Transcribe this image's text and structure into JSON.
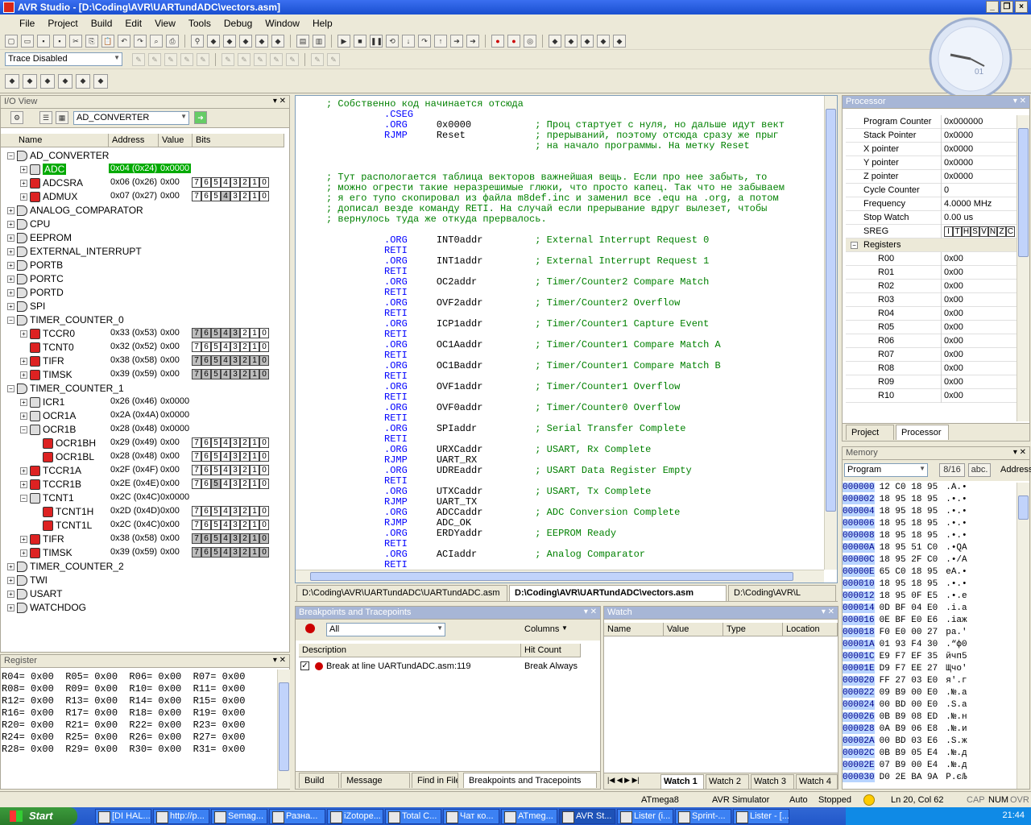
{
  "window": {
    "title": "AVR Studio - [D:\\Coding\\AVR\\UARTundADC\\vectors.asm]",
    "min": "_",
    "max": "❐",
    "close": "×"
  },
  "menu": [
    "File",
    "Project",
    "Build",
    "Edit",
    "View",
    "Tools",
    "Debug",
    "Window",
    "Help"
  ],
  "trace_combo": "Trace Disabled",
  "io_view": {
    "title": "I/O View",
    "combo": "AD_CONVERTER",
    "columns": [
      "Name",
      "Address",
      "Value",
      "Bits"
    ],
    "rows": [
      {
        "depth": 0,
        "exp": "−",
        "name": "AD_CONVERTER"
      },
      {
        "depth": 1,
        "exp": "+",
        "name": "ADC",
        "addr": "0x04 (0x24)",
        "val": "0x0000",
        "sel": true
      },
      {
        "depth": 1,
        "exp": "+",
        "name": "ADCSRA",
        "addr": "0x06 (0x26)",
        "val": "0x00",
        "bits": "76543210",
        "g": "00000000"
      },
      {
        "depth": 1,
        "exp": "+",
        "name": "ADMUX",
        "addr": "0x07 (0x27)",
        "val": "0x00",
        "bits": "76543210",
        "g": "00010000"
      },
      {
        "depth": 0,
        "exp": "+",
        "name": "ANALOG_COMPARATOR"
      },
      {
        "depth": 0,
        "exp": "+",
        "name": "CPU"
      },
      {
        "depth": 0,
        "exp": "+",
        "name": "EEPROM"
      },
      {
        "depth": 0,
        "exp": "+",
        "name": "EXTERNAL_INTERRUPT"
      },
      {
        "depth": 0,
        "exp": "+",
        "name": "PORTB"
      },
      {
        "depth": 0,
        "exp": "+",
        "name": "PORTC"
      },
      {
        "depth": 0,
        "exp": "+",
        "name": "PORTD"
      },
      {
        "depth": 0,
        "exp": "+",
        "name": "SPI"
      },
      {
        "depth": 0,
        "exp": "−",
        "name": "TIMER_COUNTER_0"
      },
      {
        "depth": 1,
        "exp": "+",
        "name": "TCCR0",
        "addr": "0x33 (0x53)",
        "val": "0x00",
        "bits": "76543210",
        "g": "11111000"
      },
      {
        "depth": 1,
        "exp": "",
        "name": "TCNT0",
        "addr": "0x32 (0x52)",
        "val": "0x00",
        "bits": "76543210",
        "g": "00000000"
      },
      {
        "depth": 1,
        "exp": "+",
        "name": "TIFR",
        "addr": "0x38 (0x58)",
        "val": "0x00",
        "bits": "76543210",
        "g": "11111111"
      },
      {
        "depth": 1,
        "exp": "+",
        "name": "TIMSK",
        "addr": "0x39 (0x59)",
        "val": "0x00",
        "bits": "76543210",
        "g": "11111111"
      },
      {
        "depth": 0,
        "exp": "−",
        "name": "TIMER_COUNTER_1"
      },
      {
        "depth": 1,
        "exp": "+",
        "name": "ICR1",
        "addr": "0x26 (0x46)",
        "val": "0x0000"
      },
      {
        "depth": 1,
        "exp": "+",
        "name": "OCR1A",
        "addr": "0x2A (0x4A)",
        "val": "0x0000"
      },
      {
        "depth": 1,
        "exp": "−",
        "name": "OCR1B",
        "addr": "0x28 (0x48)",
        "val": "0x0000"
      },
      {
        "depth": 2,
        "exp": "",
        "name": "OCR1BH",
        "addr": "0x29 (0x49)",
        "val": "0x00",
        "bits": "76543210",
        "g": "00000000"
      },
      {
        "depth": 2,
        "exp": "",
        "name": "OCR1BL",
        "addr": "0x28 (0x48)",
        "val": "0x00",
        "bits": "76543210",
        "g": "00000000"
      },
      {
        "depth": 1,
        "exp": "+",
        "name": "TCCR1A",
        "addr": "0x2F (0x4F)",
        "val": "0x00",
        "bits": "76543210",
        "g": "00000000"
      },
      {
        "depth": 1,
        "exp": "+",
        "name": "TCCR1B",
        "addr": "0x2E (0x4E)",
        "val": "0x00",
        "bits": "76543210",
        "g": "00100000"
      },
      {
        "depth": 1,
        "exp": "−",
        "name": "TCNT1",
        "addr": "0x2C (0x4C)",
        "val": "0x0000"
      },
      {
        "depth": 2,
        "exp": "",
        "name": "TCNT1H",
        "addr": "0x2D (0x4D)",
        "val": "0x00",
        "bits": "76543210",
        "g": "00000000"
      },
      {
        "depth": 2,
        "exp": "",
        "name": "TCNT1L",
        "addr": "0x2C (0x4C)",
        "val": "0x00",
        "bits": "76543210",
        "g": "00000000"
      },
      {
        "depth": 1,
        "exp": "+",
        "name": "TIFR",
        "addr": "0x38 (0x58)",
        "val": "0x00",
        "bits": "76543210",
        "g": "11111111"
      },
      {
        "depth": 1,
        "exp": "+",
        "name": "TIMSK",
        "addr": "0x39 (0x59)",
        "val": "0x00",
        "bits": "76543210",
        "g": "11111111"
      },
      {
        "depth": 0,
        "exp": "+",
        "name": "TIMER_COUNTER_2"
      },
      {
        "depth": 0,
        "exp": "+",
        "name": "TWI"
      },
      {
        "depth": 0,
        "exp": "+",
        "name": "USART"
      },
      {
        "depth": 0,
        "exp": "+",
        "name": "WATCHDOG"
      }
    ]
  },
  "register_panel": {
    "title": "Register",
    "lines": [
      "R04= 0x00  R05= 0x00  R06= 0x00  R07= 0x00",
      "R08= 0x00  R09= 0x00  R10= 0x00  R11= 0x00",
      "R12= 0x00  R13= 0x00  R14= 0x00  R15= 0x00",
      "R16= 0x00  R17= 0x00  R18= 0x00  R19= 0x00",
      "R20= 0x00  R21= 0x00  R22= 0x00  R23= 0x00",
      "R24= 0x00  R25= 0x00  R26= 0x00  R27= 0x00",
      "R28= 0x00  R29= 0x00  R30= 0x00  R31= 0x00"
    ]
  },
  "editor": {
    "lines": [
      {
        "t": "c",
        "s": "; Собственно код начинается отсюда"
      },
      {
        "t": "d",
        "s": "          .CSEG"
      },
      {
        "t": "d",
        "s": "          .ORG     0x0000           ; Проц стартует с нуля, но дальше идут вект"
      },
      {
        "t": "d",
        "s": "          RJMP     Reset            ; прерываний, поэтому отсюда сразу же прыг",
        "arrow": true
      },
      {
        "t": "c",
        "s": "                                    ; на начало программы. На метку Reset"
      },
      {
        "t": "b",
        "s": ""
      },
      {
        "t": "b",
        "s": ""
      },
      {
        "t": "c",
        "s": "; Тут распологается таблица векторов важнейшая вещь. Если про нее забыть, то"
      },
      {
        "t": "c",
        "s": "; можно огрести такие неразрешимые глюки, что просто капец. Так что не забываем"
      },
      {
        "t": "c",
        "s": "; я его тупо скопировал из файла m8def.inc и заменил все .equ на .org, а потом"
      },
      {
        "t": "c",
        "s": "; дописал везде команду RETI. На случай если прерывание вдруг вылезет, чтобы"
      },
      {
        "t": "c",
        "s": "; вернулось туда же откуда прервалось."
      },
      {
        "t": "b",
        "s": ""
      },
      {
        "t": "d",
        "s": "          .ORG     INT0addr         ; External Interrupt Request 0"
      },
      {
        "t": "k",
        "s": "          RETI"
      },
      {
        "t": "d",
        "s": "          .ORG     INT1addr         ; External Interrupt Request 1"
      },
      {
        "t": "k",
        "s": "          RETI"
      },
      {
        "t": "d",
        "s": "          .ORG     OC2addr          ; Timer/Counter2 Compare Match"
      },
      {
        "t": "k",
        "s": "          RETI"
      },
      {
        "t": "d",
        "s": "          .ORG     OVF2addr         ; Timer/Counter2 Overflow"
      },
      {
        "t": "k",
        "s": "          RETI"
      },
      {
        "t": "d",
        "s": "          .ORG     ICP1addr         ; Timer/Counter1 Capture Event"
      },
      {
        "t": "k",
        "s": "          RETI"
      },
      {
        "t": "d",
        "s": "          .ORG     OC1Aaddr         ; Timer/Counter1 Compare Match A"
      },
      {
        "t": "k",
        "s": "          RETI"
      },
      {
        "t": "d",
        "s": "          .ORG     OC1Baddr         ; Timer/Counter1 Compare Match B"
      },
      {
        "t": "k",
        "s": "          RETI"
      },
      {
        "t": "d",
        "s": "          .ORG     OVF1addr         ; Timer/Counter1 Overflow"
      },
      {
        "t": "k",
        "s": "          RETI"
      },
      {
        "t": "d",
        "s": "          .ORG     OVF0addr         ; Timer/Counter0 Overflow"
      },
      {
        "t": "k",
        "s": "          RETI"
      },
      {
        "t": "d",
        "s": "          .ORG     SPIaddr          ; Serial Transfer Complete"
      },
      {
        "t": "k",
        "s": "          RETI"
      },
      {
        "t": "d",
        "s": "          .ORG     URXCaddr         ; USART, Rx Complete"
      },
      {
        "t": "k",
        "s": "          RJMP     UART_RX"
      },
      {
        "t": "d",
        "s": "          .ORG     UDREaddr         ; USART Data Register Empty"
      },
      {
        "t": "k",
        "s": "          RETI"
      },
      {
        "t": "d",
        "s": "          .ORG     UTXCaddr         ; USART, Tx Complete"
      },
      {
        "t": "k",
        "s": "          RJMP     UART_TX"
      },
      {
        "t": "d",
        "s": "          .ORG     ADCCaddr         ; ADC Conversion Complete"
      },
      {
        "t": "k",
        "s": "          RJMP     ADC_OK"
      },
      {
        "t": "d",
        "s": "          .ORG     ERDYaddr         ; EEPROM Ready"
      },
      {
        "t": "k",
        "s": "          RETI"
      },
      {
        "t": "d",
        "s": "          .ORG     ACIaddr          ; Analog Comparator"
      },
      {
        "t": "k",
        "s": "          RETI"
      }
    ],
    "tabs": [
      "D:\\Coding\\AVR\\UARTundADC\\UARTundADC.asm",
      "D:\\Coding\\AVR\\UARTundADC\\vectors.asm",
      "D:\\Coding\\AVR\\L"
    ]
  },
  "breakpoints": {
    "title": "Breakpoints and Tracepoints",
    "filter": "All",
    "columns_btn": "Columns",
    "cols": [
      "Description",
      "Hit Count"
    ],
    "rows": [
      {
        "desc": "Break at line UARTundADC.asm:119",
        "hit": "Break Always"
      }
    ],
    "tabs": [
      "Build",
      "Message",
      "Find in Files",
      "Breakpoints and Tracepoints"
    ]
  },
  "watch": {
    "title": "Watch",
    "cols": [
      "Name",
      "Value",
      "Type",
      "Location"
    ],
    "tabs": [
      "Watch 1",
      "Watch 2",
      "Watch 3",
      "Watch 4"
    ]
  },
  "processor": {
    "title": "Processor",
    "rows": [
      {
        "k": "Program Counter",
        "v": "0x000000"
      },
      {
        "k": "Stack Pointer",
        "v": "0x0000"
      },
      {
        "k": "X pointer",
        "v": "0x0000"
      },
      {
        "k": "Y pointer",
        "v": "0x0000"
      },
      {
        "k": "Z pointer",
        "v": "0x0000"
      },
      {
        "k": "Cycle Counter",
        "v": "0"
      },
      {
        "k": "Frequency",
        "v": "4.0000 MHz"
      },
      {
        "k": "Stop Watch",
        "v": "0.00 us"
      },
      {
        "k": "SREG",
        "v": "ITHSVNZC"
      },
      {
        "k": "Registers",
        "v": "",
        "grp": true
      },
      {
        "k": "R00",
        "v": "0x00",
        "sub": true
      },
      {
        "k": "R01",
        "v": "0x00",
        "sub": true
      },
      {
        "k": "R02",
        "v": "0x00",
        "sub": true
      },
      {
        "k": "R03",
        "v": "0x00",
        "sub": true
      },
      {
        "k": "R04",
        "v": "0x00",
        "sub": true
      },
      {
        "k": "R05",
        "v": "0x00",
        "sub": true
      },
      {
        "k": "R06",
        "v": "0x00",
        "sub": true
      },
      {
        "k": "R07",
        "v": "0x00",
        "sub": true
      },
      {
        "k": "R08",
        "v": "0x00",
        "sub": true
      },
      {
        "k": "R09",
        "v": "0x00",
        "sub": true
      },
      {
        "k": "R10",
        "v": "0x00",
        "sub": true
      }
    ],
    "tabs": [
      "Project",
      "Processor"
    ]
  },
  "memory": {
    "title": "Memory",
    "combo": "Program",
    "width_btn": "8/16",
    "abc_btn": "abc.",
    "addr_label": "Address",
    "rows": [
      {
        "a": "000000",
        "h": "12 C0 18 95",
        "t": ".A.•"
      },
      {
        "a": "000002",
        "h": "18 95 18 95",
        "t": ".•.•"
      },
      {
        "a": "000004",
        "h": "18 95 18 95",
        "t": ".•.•"
      },
      {
        "a": "000006",
        "h": "18 95 18 95",
        "t": ".•.•"
      },
      {
        "a": "000008",
        "h": "18 95 18 95",
        "t": ".•.•"
      },
      {
        "a": "00000A",
        "h": "18 95 51 C0",
        "t": ".•QA"
      },
      {
        "a": "00000C",
        "h": "18 95 2F C0",
        "t": ".•/A"
      },
      {
        "a": "00000E",
        "h": "65 C0 18 95",
        "t": "eA.•"
      },
      {
        "a": "000010",
        "h": "18 95 18 95",
        "t": ".•.•"
      },
      {
        "a": "000012",
        "h": "18 95 0F E5",
        "t": ".•.e"
      },
      {
        "a": "000014",
        "h": "0D BF 04 E0",
        "t": ".i.a"
      },
      {
        "a": "000016",
        "h": "0E BF E0 E6",
        "t": ".iaж"
      },
      {
        "a": "000018",
        "h": "F0 E0 00 27",
        "t": "pa.'"
      },
      {
        "a": "00001A",
        "h": "01 93 F4 30",
        "t": ".“ф0"
      },
      {
        "a": "00001C",
        "h": "E9 F7 EF 35",
        "t": "йчп5"
      },
      {
        "a": "00001E",
        "h": "D9 F7 EE 27",
        "t": "Щчо'"
      },
      {
        "a": "000020",
        "h": "FF 27 03 E0",
        "t": "я'.г"
      },
      {
        "a": "000022",
        "h": "09 B9 00 E0",
        "t": ".№.a"
      },
      {
        "a": "000024",
        "h": "00 BD 00 E0",
        "t": ".S.a"
      },
      {
        "a": "000026",
        "h": "0B B9 08 ED",
        "t": ".№.н"
      },
      {
        "a": "000028",
        "h": "0A B9 06 E8",
        "t": ".№.и"
      },
      {
        "a": "00002A",
        "h": "00 BD 03 E6",
        "t": ".S.ж"
      },
      {
        "a": "00002C",
        "h": "0B B9 05 E4",
        "t": ".№.д"
      },
      {
        "a": "00002E",
        "h": "07 B9 00 E4",
        "t": ".№.д"
      },
      {
        "a": "000030",
        "h": "D0 2E BA 9A",
        "t": "P.єЉ"
      }
    ]
  },
  "statusbar": {
    "device": "ATmega8",
    "platform": "AVR Simulator",
    "mode": "Auto",
    "state": "Stopped",
    "pos": "Ln 20, Col 62",
    "caps": "CAP",
    "num": "NUM",
    "ovr": "OVR"
  },
  "taskbar": {
    "start": "Start",
    "tasks": [
      "[DI HAL...",
      "http://p...",
      "Semag...",
      "Разна...",
      "iZotope...",
      "Total C...",
      "Чат ко...",
      "ATmeg...",
      "AVR St...",
      "Lister (i...",
      "Sprint-...",
      "Lister - [..."
    ],
    "time": "21:44"
  }
}
